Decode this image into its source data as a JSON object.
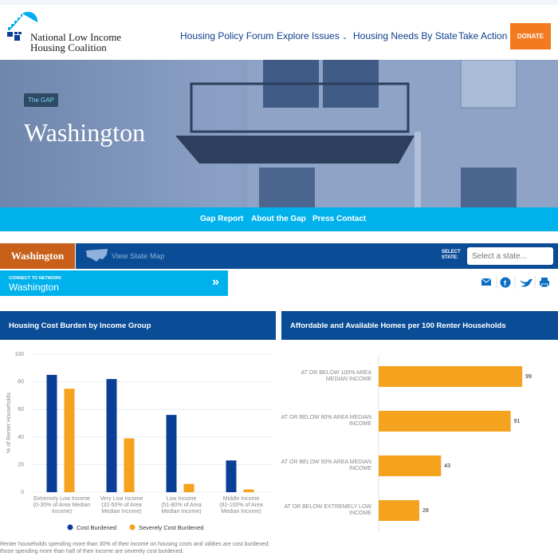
{
  "header": {
    "org_name_line1": "National Low Income",
    "org_name_line2": "Housing Coalition",
    "nav": [
      {
        "label": "Housing Policy Forum"
      },
      {
        "label": "Explore Issues"
      },
      {
        "label": "Housing Needs By State"
      },
      {
        "label": "Take Action"
      }
    ],
    "donate": "DONATE"
  },
  "hero": {
    "badge": "The GAP",
    "title": "Washington"
  },
  "subnav": [
    "Gap Report",
    "About the Gap",
    "Press Contact"
  ],
  "statebar": {
    "state": "Washington",
    "map_link": "View State Map",
    "select_label1": "SELECT",
    "select_label2": "STATE:",
    "select_placeholder": "Select a state..."
  },
  "connect": {
    "label": "CONNECT TO NETWORK",
    "state": "Washington"
  },
  "share_icons": [
    "email-icon",
    "facebook-icon",
    "twitter-icon",
    "print-icon"
  ],
  "colors": {
    "navy": "#0a4d96",
    "orange": "#f5a21e",
    "cyan": "#00b2ec",
    "rust": "#c8601a",
    "donate": "#f37a20"
  },
  "chart_data": [
    {
      "type": "bar",
      "title": "Housing Cost Burden by Income Group",
      "ylabel": "% of Renter Households",
      "ylim": [
        0,
        100
      ],
      "yticks": [
        0,
        20,
        40,
        60,
        80,
        100
      ],
      "grid": true,
      "legend": "bottom",
      "categories": [
        [
          "Extremely Low Income",
          "(0-30% of Area Median",
          "Income)"
        ],
        [
          "Very Low Income",
          "(31-50% of Area",
          "Median Income)"
        ],
        [
          "Low Income",
          "(51-80% of Area",
          "Median Income)"
        ],
        [
          "Middle Income",
          "(81-100% of Area",
          "Median Income)"
        ]
      ],
      "series": [
        {
          "name": "Cost Burdened",
          "color": "#0a3f97",
          "values": [
            85,
            82,
            56,
            23
          ]
        },
        {
          "name": "Severely Cost Burdened",
          "color": "#f5a21e",
          "values": [
            75,
            39,
            6,
            2
          ]
        }
      ],
      "note": "Renter households spending more than 30% of their income on housing costs and utilities are cost burdened; those spending more than half of their income are severely cost burdened."
    },
    {
      "type": "bar",
      "orientation": "horizontal",
      "title": "Affordable and Available Homes per 100 Renter Households",
      "xlim": [
        0,
        100
      ],
      "color": "#f5a21e",
      "categories": [
        [
          "AT OR BELOW 100% AREA",
          "MEDIAN INCOME"
        ],
        [
          "AT OR BELOW 80% AREA MEDIAN",
          "INCOME"
        ],
        [
          "AT OR BELOW 50% AREA MEDIAN",
          "INCOME"
        ],
        [
          "AT OR BELOW EXTREMELY LOW",
          "INCOME"
        ]
      ],
      "values": [
        99,
        91,
        43,
        28
      ]
    }
  ]
}
